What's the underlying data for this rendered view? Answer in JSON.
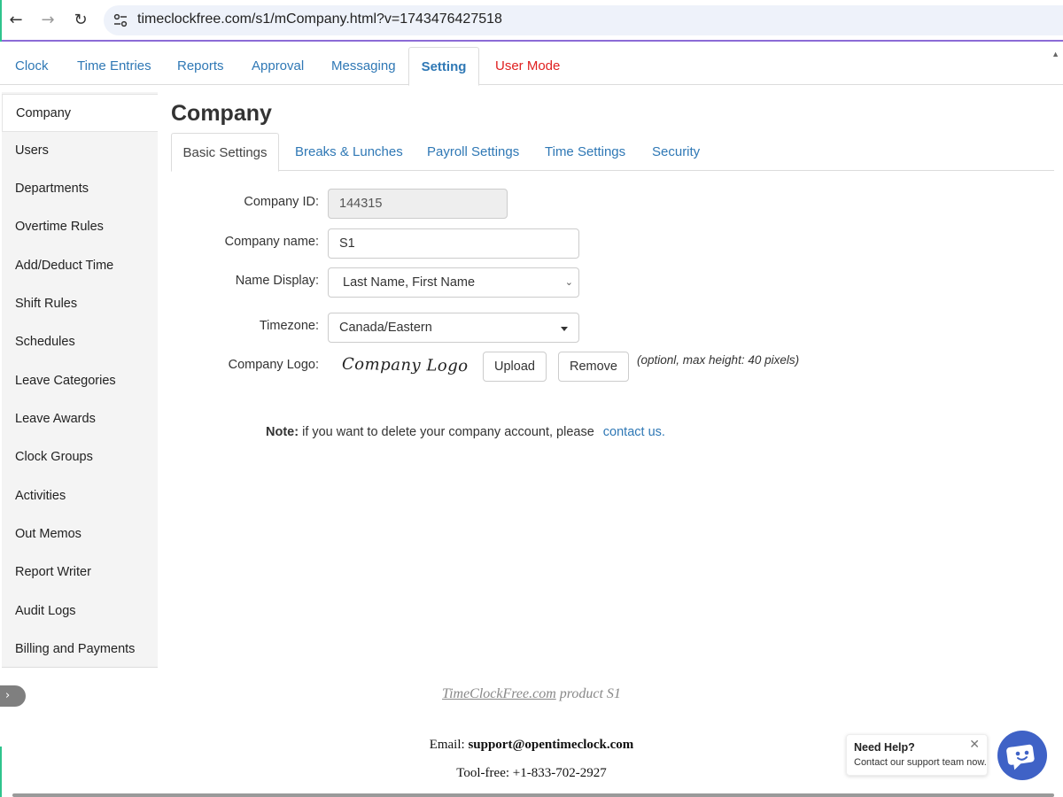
{
  "browser": {
    "url": "timeclockfree.com/s1/mCompany.html?v=1743476427518"
  },
  "top_tabs": [
    {
      "label": "Clock"
    },
    {
      "label": "Time Entries"
    },
    {
      "label": "Reports"
    },
    {
      "label": "Approval"
    },
    {
      "label": "Messaging"
    },
    {
      "label": "Setting"
    },
    {
      "label": "User Mode"
    }
  ],
  "sidebar": {
    "items": [
      {
        "label": "Company"
      },
      {
        "label": "Users"
      },
      {
        "label": "Departments"
      },
      {
        "label": "Overtime Rules"
      },
      {
        "label": "Add/Deduct Time"
      },
      {
        "label": "Shift Rules"
      },
      {
        "label": "Schedules"
      },
      {
        "label": "Leave Categories"
      },
      {
        "label": "Leave Awards"
      },
      {
        "label": "Clock Groups"
      },
      {
        "label": "Activities"
      },
      {
        "label": "Out Memos"
      },
      {
        "label": "Report Writer"
      },
      {
        "label": "Audit Logs"
      },
      {
        "label": "Billing and Payments"
      }
    ]
  },
  "main": {
    "title": "Company",
    "sub_tabs": [
      {
        "label": "Basic Settings"
      },
      {
        "label": "Breaks & Lunches"
      },
      {
        "label": "Payroll Settings"
      },
      {
        "label": "Time Settings"
      },
      {
        "label": "Security"
      }
    ],
    "form": {
      "company_id_label": "Company ID:",
      "company_id_value": "144315",
      "company_name_label": "Company name:",
      "company_name_value": "S1",
      "name_display_label": "Name Display:",
      "name_display_value": "Last Name, First Name",
      "timezone_label": "Timezone:",
      "timezone_value": "Canada/Eastern",
      "company_logo_label": "Company Logo:",
      "logo_placeholder": "Company Logo",
      "upload_label": "Upload",
      "remove_label": "Remove",
      "logo_hint": "(optionl, max height: 40 pixels)"
    },
    "note": {
      "bold": "Note:",
      "text": "if you want to delete your company account, please",
      "link": "contact us."
    }
  },
  "footer": {
    "product_link": "TimeClockFree.com",
    "product_suffix": "product S1",
    "email_label": "Email:",
    "email_value": "support@opentimeclock.com",
    "phone": "Tool-free: +1-833-702-2927"
  },
  "help_widget": {
    "title": "Need Help?",
    "subtitle": "Contact our support team now."
  },
  "colors": {
    "link": "#2f78b5",
    "user_mode": "#e02020",
    "accent": "#3f62c6"
  }
}
